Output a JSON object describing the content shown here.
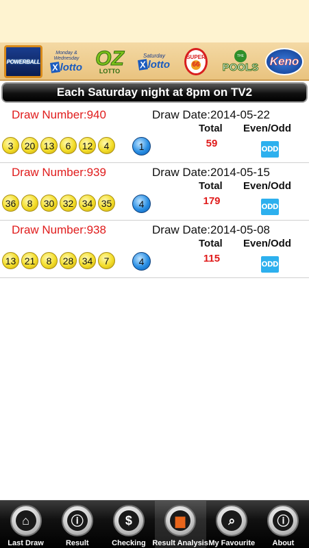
{
  "logos": {
    "powerball": "POWERBALL",
    "mw_small": "Monday & Wednesday",
    "mw_brand": "lotto",
    "oz_big": "OZ",
    "oz_sub": "LOTTO",
    "sat_small": "Saturday",
    "sat_brand": "lotto",
    "super_top": "SUPER",
    "super_num": "66",
    "pools_top": "THE",
    "pools": "POOLS",
    "keno": "Keno"
  },
  "banner": "Each Saturday night at 8pm on TV2",
  "headers": {
    "total": "Total",
    "even_odd": "Even/Odd"
  },
  "draws": [
    {
      "draw_number": "Draw Number:940",
      "draw_date": "Draw Date:2014-05-22",
      "balls": [
        "3",
        "20",
        "13",
        "6",
        "12",
        "4"
      ],
      "powerball": "1",
      "total": "59",
      "even_odd": "ODD"
    },
    {
      "draw_number": "Draw Number:939",
      "draw_date": "Draw Date:2014-05-15",
      "balls": [
        "36",
        "8",
        "30",
        "32",
        "34",
        "35"
      ],
      "powerball": "4",
      "total": "179",
      "even_odd": "ODD"
    },
    {
      "draw_number": "Draw Number:938",
      "draw_date": "Draw Date:2014-05-08",
      "balls": [
        "13",
        "21",
        "8",
        "28",
        "34",
        "7"
      ],
      "powerball": "4",
      "total": "115",
      "even_odd": "ODD"
    }
  ],
  "tabs": [
    {
      "label": "Last Draw",
      "icon": "home-icon",
      "glyph": "⌂"
    },
    {
      "label": "Result",
      "icon": "info-icon",
      "glyph": "ⓘ"
    },
    {
      "label": "Checking",
      "icon": "dollar-icon",
      "glyph": "$"
    },
    {
      "label": "Result Analysis",
      "icon": "bar-chart-icon",
      "glyph": "▆"
    },
    {
      "label": "My Favourite",
      "icon": "search-icon",
      "glyph": "⌕"
    },
    {
      "label": "About",
      "icon": "info-icon",
      "glyph": "ⓘ"
    }
  ],
  "active_tab": 3
}
